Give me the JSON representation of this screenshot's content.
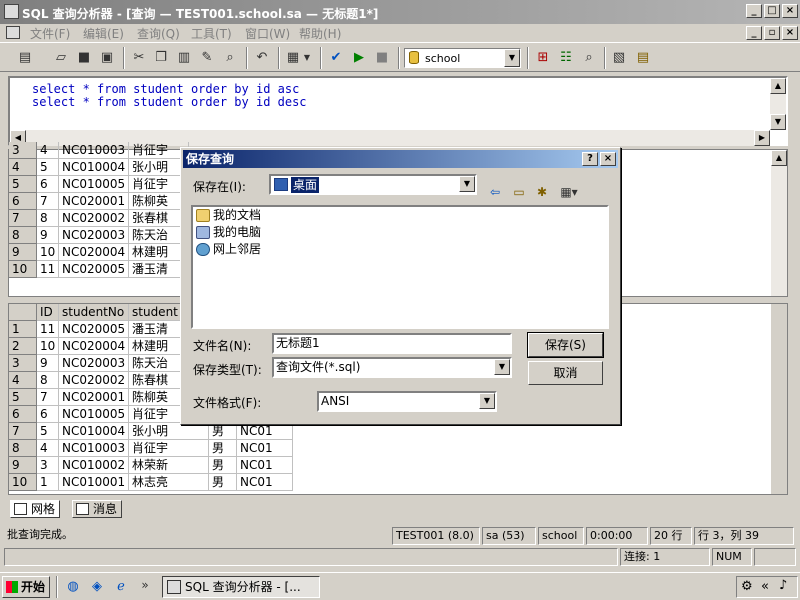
{
  "window": {
    "title": "SQL 查询分析器 - [查询 — TEST001.school.sa — 无标题1*]"
  },
  "menu": [
    "文件(F)",
    "编辑(E)",
    "查询(Q)",
    "工具(T)",
    "窗口(W)",
    "帮助(H)"
  ],
  "toolbar": {
    "database": "school"
  },
  "editor": {
    "lines": [
      "select * from student order by id asc",
      "select * from student order by id desc"
    ]
  },
  "grid1": {
    "rows": [
      {
        "rn": "3",
        "id": "4",
        "no": "NC010003",
        "name": "肖征宇"
      },
      {
        "rn": "4",
        "id": "5",
        "no": "NC010004",
        "name": "张小明"
      },
      {
        "rn": "5",
        "id": "6",
        "no": "NC010005",
        "name": "肖征宇"
      },
      {
        "rn": "6",
        "id": "7",
        "no": "NC020001",
        "name": "陈柳英"
      },
      {
        "rn": "7",
        "id": "8",
        "no": "NC020002",
        "name": "张春棋"
      },
      {
        "rn": "8",
        "id": "9",
        "no": "NC020003",
        "name": "陈天治"
      },
      {
        "rn": "9",
        "id": "10",
        "no": "NC020004",
        "name": "林建明"
      },
      {
        "rn": "10",
        "id": "11",
        "no": "NC020005",
        "name": "潘玉清"
      }
    ]
  },
  "grid2": {
    "headers": [
      "ID",
      "studentNo",
      "student"
    ],
    "rows": [
      {
        "rn": "1",
        "id": "11",
        "no": "NC020005",
        "name": "潘玉清",
        "sex": "",
        "cls": ""
      },
      {
        "rn": "2",
        "id": "10",
        "no": "NC020004",
        "name": "林建明",
        "sex": "",
        "cls": ""
      },
      {
        "rn": "3",
        "id": "9",
        "no": "NC020003",
        "name": "陈天治",
        "sex": "",
        "cls": ""
      },
      {
        "rn": "4",
        "id": "8",
        "no": "NC020002",
        "name": "陈春棋",
        "sex": "",
        "cls": ""
      },
      {
        "rn": "5",
        "id": "7",
        "no": "NC020001",
        "name": "陈柳英",
        "sex": "",
        "cls": ""
      },
      {
        "rn": "6",
        "id": "6",
        "no": "NC010005",
        "name": "肖征宇",
        "sex": "",
        "cls": ""
      },
      {
        "rn": "7",
        "id": "5",
        "no": "NC010004",
        "name": "张小明",
        "sex": "男",
        "cls": "NC01"
      },
      {
        "rn": "8",
        "id": "4",
        "no": "NC010003",
        "name": "肖征宇",
        "sex": "男",
        "cls": "NC01"
      },
      {
        "rn": "9",
        "id": "3",
        "no": "NC010002",
        "name": "林荣新",
        "sex": "男",
        "cls": "NC01"
      },
      {
        "rn": "10",
        "id": "1",
        "no": "NC010001",
        "name": "林志亮",
        "sex": "男",
        "cls": "NC01"
      }
    ]
  },
  "tabs": {
    "grid": "网格",
    "messages": "消息"
  },
  "status": {
    "message": "批查询完成。",
    "server": "TEST001 (8.0)",
    "user": "sa (53)",
    "db": "school",
    "time": "0:00:00",
    "rows": "20 行",
    "pos": "行 3，列 39",
    "conn": "连接: 1",
    "num": "NUM"
  },
  "taskbar": {
    "start": "开始",
    "task": "SQL 查询分析器 - [..."
  },
  "dialog": {
    "title": "保存查询",
    "save_in_label": "保存在(I):",
    "save_in_value": "桌面",
    "places": [
      "我的文档",
      "我的电脑",
      "网上邻居"
    ],
    "filename_label": "文件名(N):",
    "filename_value": "无标题1",
    "filetype_label": "保存类型(T):",
    "filetype_value": "查询文件(*.sql)",
    "format_label": "文件格式(F):",
    "format_value": "ANSI",
    "save_btn": "保存(S)",
    "cancel_btn": "取消"
  }
}
